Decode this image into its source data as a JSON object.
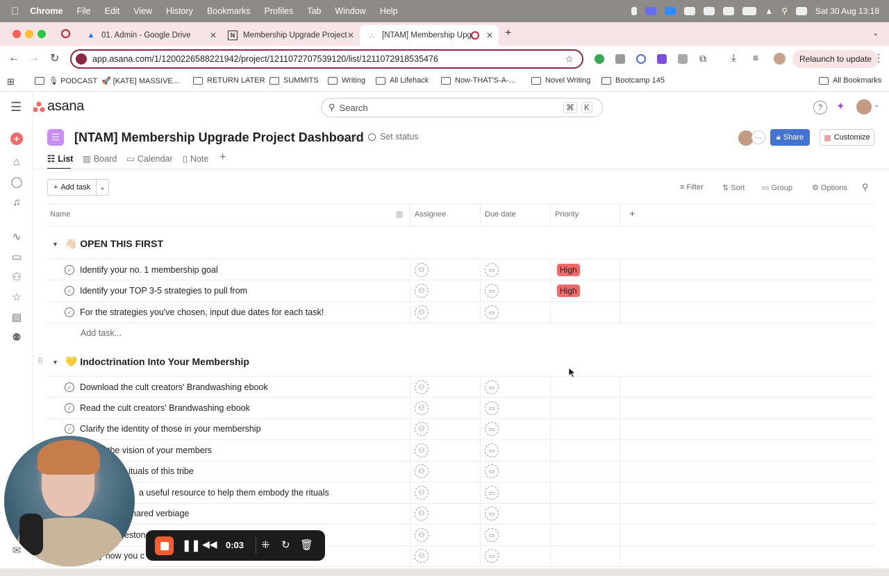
{
  "menubar": {
    "app": "Chrome",
    "items": [
      "File",
      "Edit",
      "View",
      "History",
      "Bookmarks",
      "Profiles",
      "Tab",
      "Window",
      "Help"
    ],
    "clock": "Sat 30 Aug  13:18"
  },
  "tabs": [
    {
      "title": "01. Admin - Google Drive",
      "icon": "google-drive-icon"
    },
    {
      "title": "Membership Upgrade Project",
      "icon": "notion-icon"
    },
    {
      "title": "[NTAM] Membership Upg",
      "icon": "asana-icon",
      "active": true
    }
  ],
  "browser": {
    "url": "app.asana.com/1/1200226588221942/project/1211072707539120/list/1211072918535476",
    "relaunch": "Relaunch to update"
  },
  "bookmarks": [
    {
      "label": "🎙 PODCAST"
    },
    {
      "label": "🚀 [KATE] MASSIVE..."
    },
    {
      "label": "RETURN LATER"
    },
    {
      "label": "SUMMITS"
    },
    {
      "label": "Writing"
    },
    {
      "label": "All Lifehack"
    },
    {
      "label": "Now-THAT'S-A-..."
    },
    {
      "label": "Novel Writing"
    },
    {
      "label": "Bootcamp 145"
    },
    {
      "label": "All Bookmarks"
    }
  ],
  "asana": {
    "logo": "asana",
    "search_placeholder": "Search",
    "search_shortcut_key": "K",
    "project_title": "[NTAM] Membership Upgrade Project Dashboard",
    "set_status": "Set status",
    "share": "Share",
    "customize": "Customize",
    "views": [
      "List",
      "Board",
      "Calendar",
      "Note"
    ],
    "add_task": "Add task",
    "toolbar": [
      "Filter",
      "Sort",
      "Group",
      "Options"
    ],
    "columns": [
      "Name",
      "Assignee",
      "Due date",
      "Priority"
    ],
    "sections": [
      {
        "title": "👋🏻 OPEN THIS FIRST",
        "tasks": [
          {
            "name": "Identify your no. 1 membership goal",
            "priority": "High"
          },
          {
            "name": "Identify your TOP 3-5 strategies to pull from",
            "priority": "High"
          },
          {
            "name": "For the strategies you've chosen, input due dates for each task!",
            "priority": ""
          }
        ],
        "add_task": "Add task..."
      },
      {
        "title": "💛 Indoctrination Into Your Membership",
        "tasks": [
          {
            "name": "Download the cult creators' Brandwashing ebook"
          },
          {
            "name": "Read the cult creators' Brandwashing ebook"
          },
          {
            "name": "Clarify the identity of those in your membership"
          },
          {
            "name": "the vision of your members"
          },
          {
            "name": "ituals of this tribe"
          },
          {
            "name": "a useful resource to help them embody the rituals"
          },
          {
            "name": "hared verbiage"
          },
          {
            "name": "estone"
          },
          {
            "name": "y how you c"
          }
        ]
      }
    ]
  },
  "recorder": {
    "time": "0:03"
  },
  "colors": {
    "priority_high": "#f06a6a",
    "share": "#4573d2",
    "asana_brand": "#f06a6a"
  }
}
